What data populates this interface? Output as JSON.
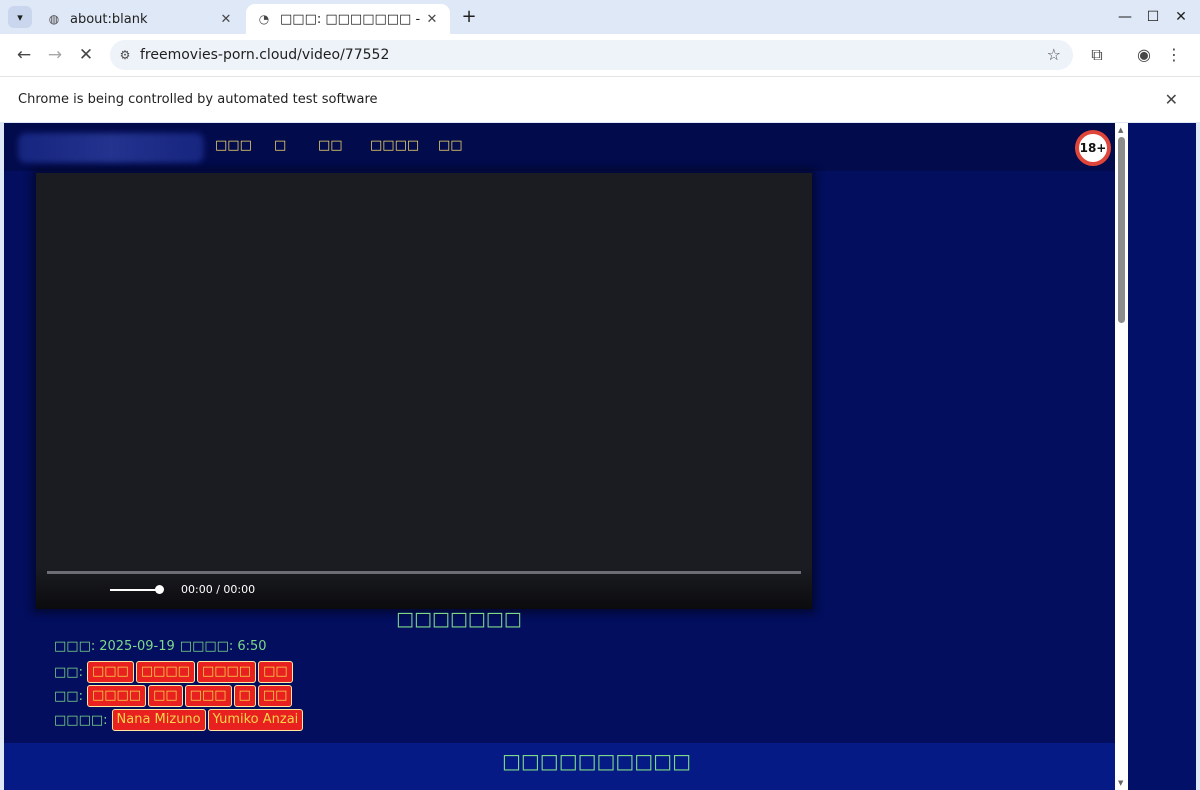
{
  "tabs": [
    {
      "title": "about:blank",
      "favicon": "globe-icon",
      "active": false
    },
    {
      "title": "□□□: □□□□□□□ - FreeMovies",
      "favicon": "loading-icon",
      "active": true
    }
  ],
  "window": {
    "minimize": "—",
    "maximize": "☐",
    "close": "✕"
  },
  "toolbar": {
    "url": "freemovies-porn.cloud/video/77552"
  },
  "infobar": {
    "message": "Chrome is being controlled by automated test software"
  },
  "site": {
    "nav": [
      "□□□",
      "□",
      "□□",
      "□□□□",
      "□□"
    ],
    "age_badge": "18+"
  },
  "player": {
    "time": "00:00 / 00:00",
    "volume": 1.0,
    "progress": 0.0
  },
  "video": {
    "title": "□□□□□□□",
    "date_label": "□□□:",
    "date": "2025-09-19",
    "duration_label": "□□□□:",
    "duration": "6:50",
    "categories_label": "□□:",
    "categories": [
      "□□□",
      "□□□□",
      "□□□□",
      "□□"
    ],
    "tags_label": "□□:",
    "tags": [
      "□□□□",
      "□□",
      "□□□",
      "□",
      "□□"
    ],
    "actors_label": "□□□□:",
    "actors": [
      "Nana Mizuno",
      "Yumiko Anzai"
    ]
  },
  "footer": {
    "title": "□□□□□□□□□□"
  }
}
